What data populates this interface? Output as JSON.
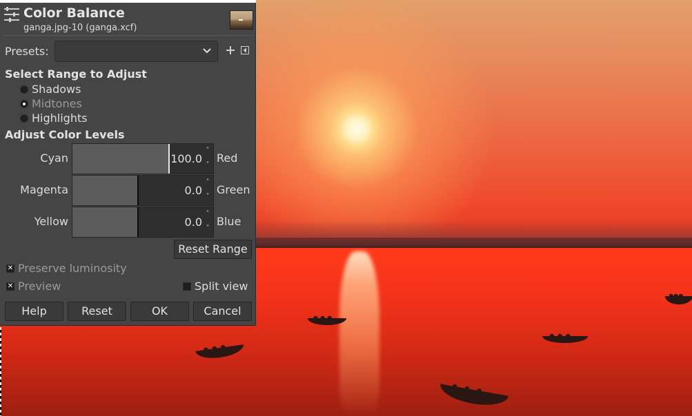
{
  "dialog": {
    "title": "Color Balance",
    "subtitle": "ganga.jpg-10 (ganga.xcf)",
    "presets_label": "Presets:",
    "presets_value": "",
    "add_icon": "plus-icon",
    "menu_icon": "triangle-left-icon",
    "range_section": "Select Range to Adjust",
    "ranges": [
      {
        "label": "Shadows",
        "selected": false
      },
      {
        "label": "Midtones",
        "selected": true
      },
      {
        "label": "Highlights",
        "selected": false
      }
    ],
    "levels_section": "Adjust Color Levels",
    "sliders": [
      {
        "left": "Cyan",
        "right": "Red",
        "value": "100.0",
        "level": 100
      },
      {
        "left": "Magenta",
        "right": "Green",
        "value": "0.0",
        "level": 0
      },
      {
        "left": "Yellow",
        "right": "Blue",
        "value": "0.0",
        "level": 0
      }
    ],
    "reset_range": "Reset Range",
    "preserve_luminosity": {
      "label": "Preserve luminosity",
      "checked": true
    },
    "preview": {
      "label": "Preview",
      "checked": true
    },
    "split_view": {
      "label": "Split view",
      "checked": false
    },
    "buttons": {
      "help": "Help",
      "reset": "Reset",
      "ok": "OK",
      "cancel": "Cancel"
    }
  },
  "colors": {
    "dialog_bg": "#454545",
    "sky_top": "#e2a06a",
    "water": "#f3321a"
  }
}
